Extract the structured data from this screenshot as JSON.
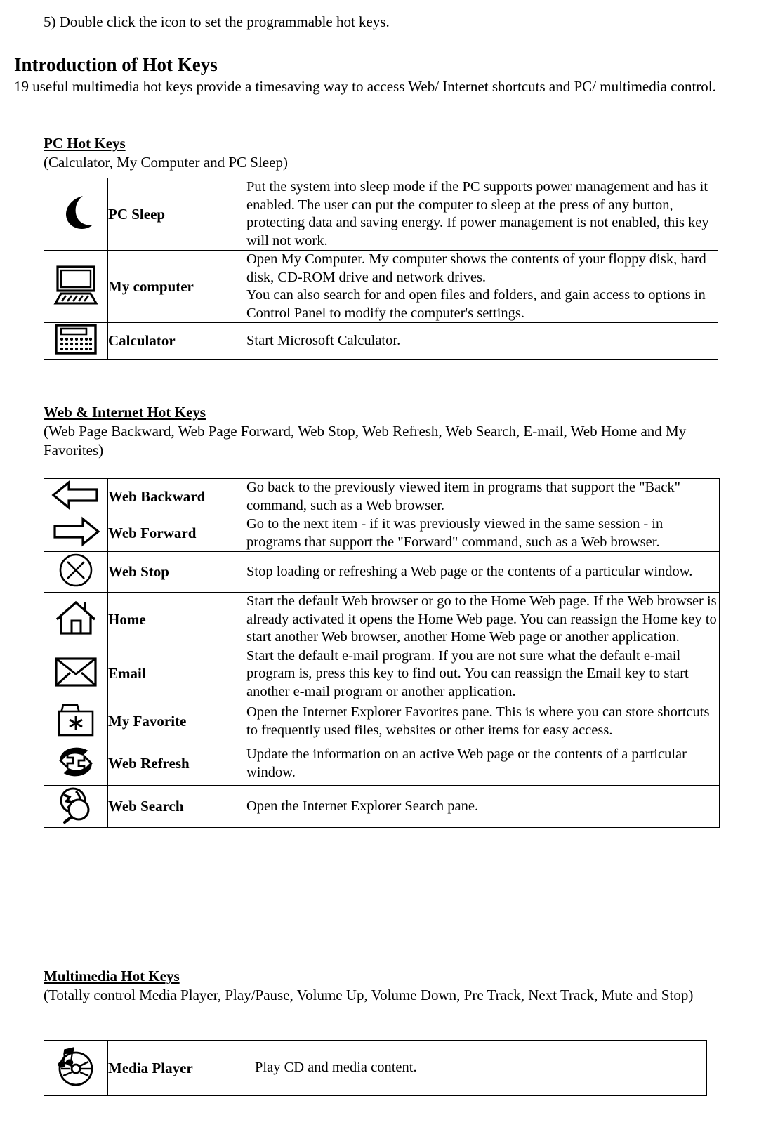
{
  "document": {
    "step_line": "5) Double click the icon to set the programmable hot keys.",
    "title": "Introduction of Hot Keys",
    "intro": "19 useful multimedia hot keys provide a timesaving way to access Web/ Internet shortcuts and PC/ multimedia control."
  },
  "sections": [
    {
      "heading": "PC Hot Keys",
      "subheading": "(Calculator, My Computer and PC Sleep)",
      "rows": [
        {
          "icon": "crescent-moon-icon",
          "name": "PC Sleep",
          "description": "Put the system into sleep mode if the PC supports power management and has it enabled. The user can put the computer to sleep at the press of any button, protecting data and saving energy. If power management is not enabled, this key will not work."
        },
        {
          "icon": "desktop-computer-icon",
          "name": "My computer",
          "description": "Open My Computer. My computer shows the contents of your floppy disk, hard disk, CD-ROM drive and network drives.\nYou can also search for and open files and folders, and gain access to options in Control Panel to modify the computer's settings."
        },
        {
          "icon": "calculator-icon",
          "name": "Calculator",
          "description": "Start Microsoft Calculator."
        }
      ]
    },
    {
      "heading": "Web & Internet Hot Keys",
      "subheading": "(Web Page Backward, Web Page Forward, Web Stop, Web Refresh, Web Search, E-mail, Web Home and My Favorites)",
      "rows": [
        {
          "icon": "arrow-left-icon",
          "name": "Web Backward",
          "description": "Go back to the previously viewed item in programs that support the \"Back\" command, such as a Web browser."
        },
        {
          "icon": "arrow-right-icon",
          "name": "Web Forward",
          "description": "Go to the next item - if it was previously viewed in the same session - in programs that support the \"Forward\" command, such as a Web browser."
        },
        {
          "icon": "circle-x-icon",
          "name": "Web Stop",
          "description": "Stop loading or refreshing a Web page or the contents of a particular window."
        },
        {
          "icon": "house-icon",
          "name": "Home",
          "description": "Start the default Web browser or go to the Home Web page. If the Web browser is already activated it opens the Home Web page. You can reassign the Home key to start another Web browser, another Home Web page or another application."
        },
        {
          "icon": "envelope-icon",
          "name": "Email",
          "description": "Start the default e-mail program. If you are not sure what the default e-mail program is, press this key to find out. You can reassign the Email key to start another e-mail program or another application."
        },
        {
          "icon": "folder-star-icon",
          "name": "My Favorite",
          "description": "Open the Internet Explorer Favorites pane. This is where you can store shortcuts to frequently used files, websites or other items for easy access."
        },
        {
          "icon": "refresh-arrows-icon",
          "name": "Web Refresh",
          "description": "Update the information on an active Web page or the contents of a particular window."
        },
        {
          "icon": "globe-magnifier-icon",
          "name": "Web Search",
          "description": "Open the Internet Explorer Search pane."
        }
      ]
    },
    {
      "heading": "Multimedia Hot Keys",
      "subheading": "(Totally control Media Player, Play/Pause, Volume Up, Volume Down, Pre Track, Next Track, Mute and Stop)",
      "rows": [
        {
          "icon": "cd-music-note-icon",
          "name": "Media Player",
          "description": "Play CD and media content."
        }
      ]
    }
  ]
}
